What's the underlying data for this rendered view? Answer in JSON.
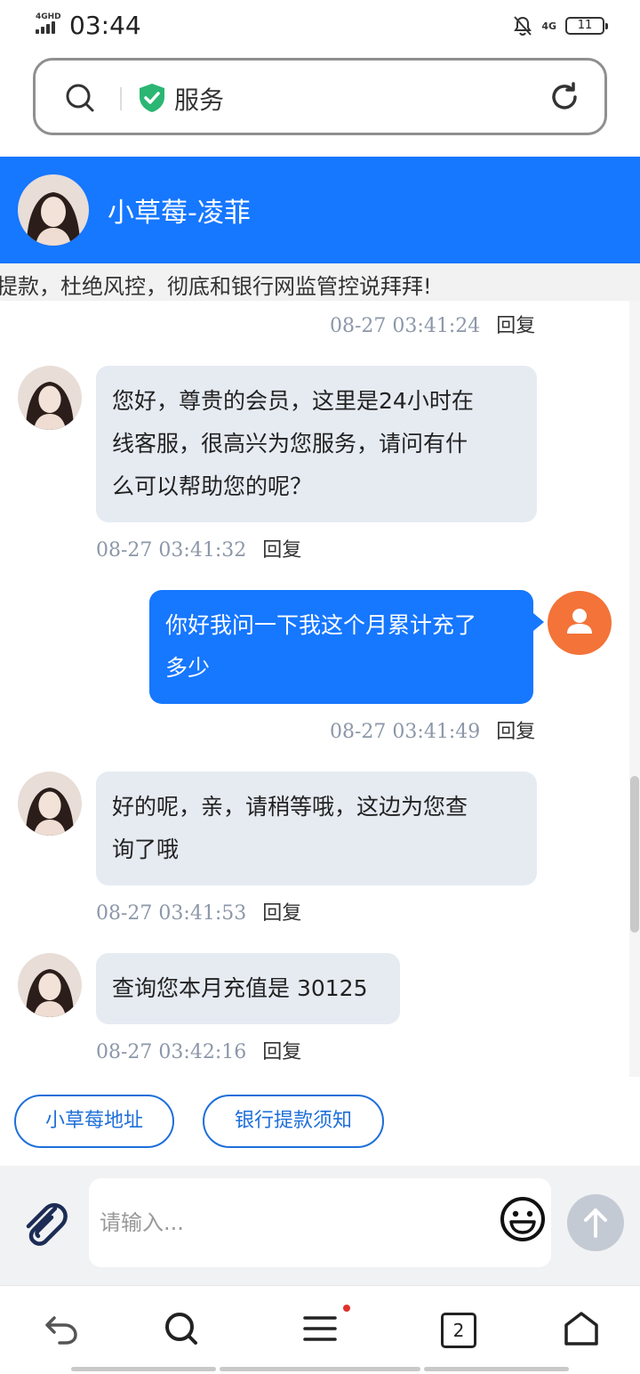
{
  "status_bar": {
    "network": "4GHD",
    "time": "03:44",
    "net_right": "4G",
    "battery": "11"
  },
  "url_bar": {
    "text": "服务"
  },
  "chat_header": {
    "title": "小草莓-凌菲"
  },
  "marquee": {
    "text": "提款，杜绝风控，彻底和银行网监管控说拜拜!"
  },
  "messages": [
    {
      "from": "agent",
      "lines": [],
      "time": "08-27 03:41:24",
      "reply": "回复"
    },
    {
      "from": "agent",
      "lines": [
        "您好，尊贵的会员，这里是24小时在",
        "线客服，很高兴为您服务，请问有什",
        "么可以帮助您的呢？"
      ],
      "time": "08-27 03:41:32",
      "reply": "回复"
    },
    {
      "from": "user",
      "lines": [
        "你好我问一下我这个月累计充了",
        "多少"
      ],
      "time": "08-27 03:41:49",
      "reply": "回复"
    },
    {
      "from": "agent",
      "lines": [
        "好的呢，亲，请稍等哦，这边为您查",
        "询了哦"
      ],
      "time": "08-27 03:41:53",
      "reply": "回复"
    },
    {
      "from": "agent",
      "lines": [
        "查询您本月充值是 30125"
      ],
      "time": "08-27 03:42:16",
      "reply": "回复"
    }
  ],
  "quick_replies": [
    "小草莓地址",
    "银行提款须知"
  ],
  "input": {
    "placeholder": "请输入..."
  },
  "bottom_nav": {
    "tabs_count": "2"
  },
  "colors": {
    "brand_blue": "#1677ff",
    "agent_bubble": "#e6ebf2",
    "user_avatar": "#f37338",
    "quick_reply_border": "#1e6fd9"
  }
}
